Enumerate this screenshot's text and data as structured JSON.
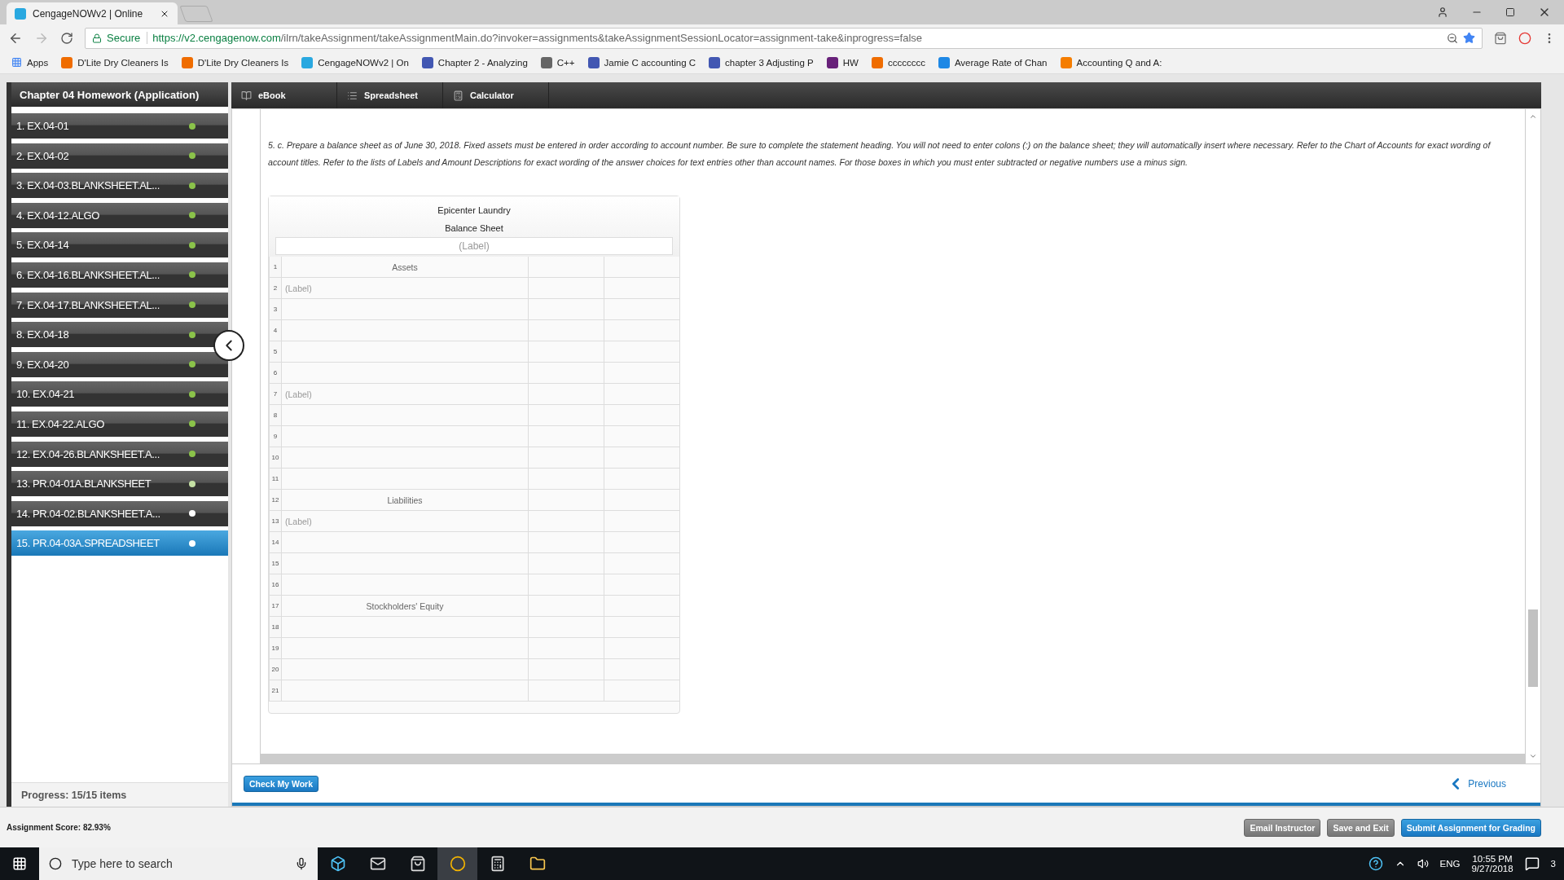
{
  "browser": {
    "tab_title": "CengageNOWv2 | Online",
    "secure_label": "Secure",
    "url_host": "https://v2.cengagenow.com",
    "url_path": "/ilrn/takeAssignment/takeAssignmentMain.do?invoker=assignments&takeAssignmentSessionLocator=assignment-take&inprogress=false",
    "bookmarks": [
      {
        "label": "Apps",
        "kind": "apps"
      },
      {
        "label": "D'Lite Dry Cleaners Is",
        "kind": "orange"
      },
      {
        "label": "D'Lite Dry Cleaners Is",
        "kind": "orange"
      },
      {
        "label": "CengageNOWv2 | On",
        "kind": "cengage"
      },
      {
        "label": "Chapter 2 - Analyzing",
        "kind": "quizlet"
      },
      {
        "label": "C++",
        "kind": "cpp"
      },
      {
        "label": "Jamie C accounting C",
        "kind": "quizlet"
      },
      {
        "label": "chapter 3 Adjusting P",
        "kind": "quizlet"
      },
      {
        "label": "HW",
        "kind": "vs"
      },
      {
        "label": "cccccccc",
        "kind": "orange"
      },
      {
        "label": "Average Rate of Chan",
        "kind": "globe"
      },
      {
        "label": "Accounting Q and A:",
        "kind": "blogger"
      }
    ]
  },
  "sidebar": {
    "title": "Chapter 04 Homework (Application)",
    "items": [
      {
        "label": "1. EX.04-01",
        "color": "#8bc34a",
        "selected": false
      },
      {
        "label": "2. EX.04-02",
        "color": "#8bc34a",
        "selected": false
      },
      {
        "label": "3. EX.04-03.BLANKSHEET.AL...",
        "color": "#8bc34a",
        "selected": false
      },
      {
        "label": "4. EX.04-12.ALGO",
        "color": "#8bc34a",
        "selected": false
      },
      {
        "label": "5. EX.04-14",
        "color": "#8bc34a",
        "selected": false
      },
      {
        "label": "6. EX.04-16.BLANKSHEET.AL...",
        "color": "#8bc34a",
        "selected": false
      },
      {
        "label": "7. EX.04-17.BLANKSHEET.AL...",
        "color": "#8bc34a",
        "selected": false
      },
      {
        "label": "8. EX.04-18",
        "color": "#8bc34a",
        "selected": false
      },
      {
        "label": "9. EX.04-20",
        "color": "#8bc34a",
        "selected": false
      },
      {
        "label": "10. EX.04-21",
        "color": "#8bc34a",
        "selected": false
      },
      {
        "label": "11. EX.04-22.ALGO",
        "color": "#8bc34a",
        "selected": false
      },
      {
        "label": "12. EX.04-26.BLANKSHEET.A...",
        "color": "#8bc34a",
        "selected": false
      },
      {
        "label": "13. PR.04-01A.BLANKSHEET",
        "color": "#c5e1a5",
        "selected": false
      },
      {
        "label": "14. PR.04-02.BLANKSHEET.A...",
        "color": "#ffffff",
        "selected": false
      },
      {
        "label": "15. PR.04-03A.SPREADSHEET",
        "color": "#ffffff",
        "selected": true
      }
    ],
    "progress": "Progress:  15/15 items"
  },
  "toolbar": [
    {
      "label": "eBook",
      "kind": "book"
    },
    {
      "label": "Spreadsheet",
      "kind": "list"
    },
    {
      "label": "Calculator",
      "kind": "calc"
    }
  ],
  "instructions": "5. c. Prepare a balance sheet as of June 30, 2018. Fixed assets must be entered in order according to account number. Be sure to complete the statement heading. You will not need to enter colons (:) on the balance sheet; they will automatically insert where necessary. Refer to the Chart of Accounts for exact wording of account titles. Refer to the lists of Labels and Amount Descriptions for exact wording of the answer choices for text entries other than account names. For those boxes in which you must enter subtracted or negative numbers use a minus sign.",
  "statement": {
    "company": "Epicenter Laundry",
    "title": "Balance Sheet",
    "date_placeholder": "(Label)",
    "rows": [
      {
        "number": "1",
        "kind": "heading",
        "text": "Assets"
      },
      {
        "number": "2",
        "kind": "input",
        "placeholder": "(Label)"
      },
      {
        "number": "3",
        "kind": "input"
      },
      {
        "number": "4",
        "kind": "input"
      },
      {
        "number": "5",
        "kind": "input"
      },
      {
        "number": "6",
        "kind": "input"
      },
      {
        "number": "7",
        "kind": "input",
        "placeholder": "(Label)"
      },
      {
        "number": "8",
        "kind": "input"
      },
      {
        "number": "9",
        "kind": "input"
      },
      {
        "number": "10",
        "kind": "input"
      },
      {
        "number": "11",
        "kind": "input"
      },
      {
        "number": "12",
        "kind": "heading",
        "text": "Liabilities"
      },
      {
        "number": "13",
        "kind": "input",
        "placeholder": "(Label)"
      },
      {
        "number": "14",
        "kind": "input"
      },
      {
        "number": "15",
        "kind": "input"
      },
      {
        "number": "16",
        "kind": "input"
      },
      {
        "number": "17",
        "kind": "heading",
        "text": "Stockholders' Equity"
      },
      {
        "number": "18",
        "kind": "input"
      },
      {
        "number": "19",
        "kind": "input"
      },
      {
        "number": "20",
        "kind": "input"
      },
      {
        "number": "21",
        "kind": "input"
      }
    ]
  },
  "check_button": "Check My Work",
  "previous_link": "Previous",
  "score": "Assignment Score: 82.93%",
  "actions": [
    {
      "label": "Email Instructor",
      "kind": "grey"
    },
    {
      "label": "Save and Exit",
      "kind": "grey"
    },
    {
      "label": "Submit Assignment for Grading",
      "kind": "primary"
    }
  ],
  "taskbar": {
    "search_placeholder": "Type here to search",
    "language": "ENG",
    "time": "10:55 PM",
    "date": "9/27/2018",
    "notifications": "3"
  }
}
